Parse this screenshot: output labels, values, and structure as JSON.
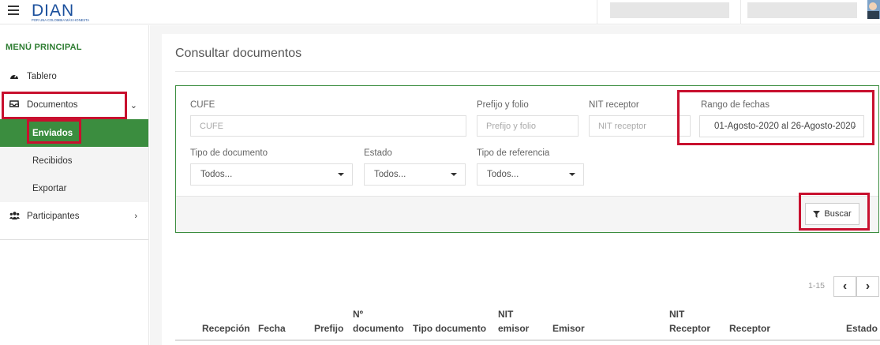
{
  "app": {
    "logo_text": "DIAN",
    "logo_tagline": "POR UNA COLOMBIA MÁS HONESTA"
  },
  "sidebar": {
    "title": "MENÚ PRINCIPAL",
    "items": [
      {
        "label": "Tablero",
        "icon": "dashboard-icon"
      },
      {
        "label": "Documentos",
        "icon": "inbox-icon"
      },
      {
        "label": "Participantes",
        "icon": "users-icon"
      }
    ],
    "sub_items": [
      {
        "label": "Enviados"
      },
      {
        "label": "Recibidos"
      },
      {
        "label": "Exportar"
      }
    ]
  },
  "main": {
    "title": "Consultar documentos",
    "filters": {
      "cufe_label": "CUFE",
      "cufe_placeholder": "CUFE",
      "prefijo_label": "Prefijo y folio",
      "prefijo_placeholder": "Prefijo y folio",
      "nit_receptor_label": "NIT receptor",
      "nit_receptor_placeholder": "NIT receptor",
      "rango_label": "Rango de fechas",
      "rango_value": "01-Agosto-2020 al 26-Agosto-2020",
      "tipo_doc_label": "Tipo de documento",
      "tipo_doc_value": "Todos...",
      "estado_label": "Estado",
      "estado_value": "Todos...",
      "tipo_ref_label": "Tipo de referencia",
      "tipo_ref_value": "Todos..."
    },
    "buscar_label": "Buscar",
    "pagination": {
      "range": "1-15",
      "prev": "‹",
      "next": "›"
    },
    "table": {
      "columns": {
        "recepcion": "Recepción",
        "fecha": "Fecha",
        "prefijo": "Prefijo",
        "numero_1": "Nº",
        "numero_2": "documento",
        "tipo_documento": "Tipo documento",
        "nit_emisor_1": "NIT",
        "nit_emisor_2": "emisor",
        "emisor": "Emisor",
        "nit_receptor_1": "NIT",
        "nit_receptor_2": "Receptor",
        "receptor": "Receptor",
        "estado": "Estado"
      }
    }
  },
  "colors": {
    "brand_green": "#3b8d3f",
    "highlight_red": "#c8102e",
    "logo_blue": "#1a4f9c"
  }
}
